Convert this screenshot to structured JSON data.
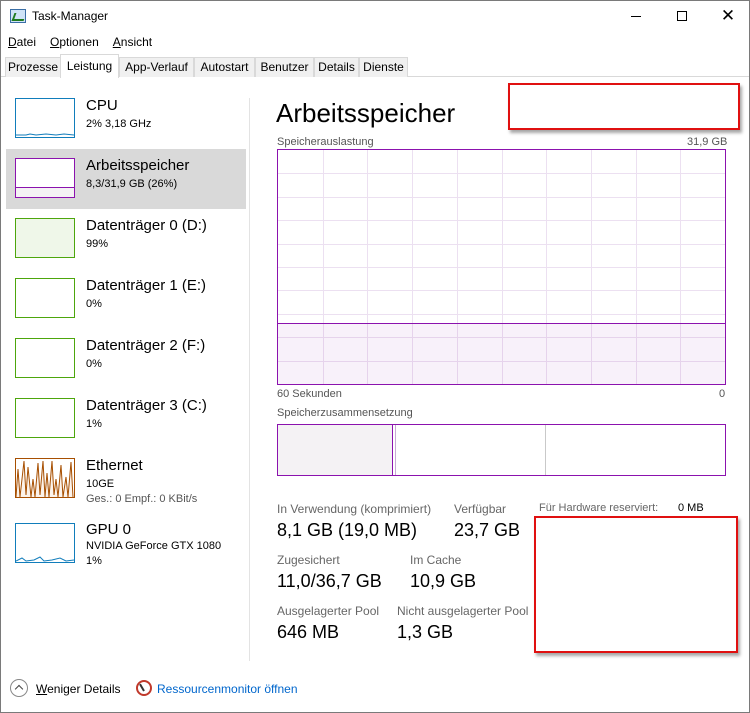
{
  "window": {
    "title": "Task-Manager",
    "close_glyph": "✕"
  },
  "menu": [
    {
      "accel": "D",
      "rest": "atei"
    },
    {
      "accel": "O",
      "rest": "ptionen"
    },
    {
      "accel": "A",
      "rest": "nsicht"
    }
  ],
  "tabs": [
    "Prozesse",
    "Leistung",
    "App-Verlauf",
    "Autostart",
    "Benutzer",
    "Details",
    "Dienste"
  ],
  "active_tab": "Leistung",
  "sidebar": {
    "items": [
      {
        "name": "CPU",
        "sub1": "2% 3,18 GHz",
        "sub2": "",
        "color": "#117dbb",
        "fill": "#f1f6fa",
        "icon": "cpu-graph-icon"
      },
      {
        "name": "Arbeitsspeicher",
        "sub1": "8,3/31,9 GB (26%)",
        "sub2": "",
        "color": "#8b12ae",
        "fill": "#f4f2f4",
        "icon": "memory-graph-icon",
        "level": 0.26
      },
      {
        "name": "Datenträger 0 (D:)",
        "sub1": "99%",
        "sub2": "",
        "color": "#4da60c",
        "fill": "#eff7e9",
        "icon": "disk-graph-icon",
        "level": 0.99
      },
      {
        "name": "Datenträger 1 (E:)",
        "sub1": "0%",
        "sub2": "",
        "color": "#4da60c",
        "fill": "#eff7e9",
        "icon": "disk-graph-icon",
        "level": 0
      },
      {
        "name": "Datenträger 2 (F:)",
        "sub1": "0%",
        "sub2": "",
        "color": "#4da60c",
        "fill": "#eff7e9",
        "icon": "disk-graph-icon",
        "level": 0
      },
      {
        "name": "Datenträger 3 (C:)",
        "sub1": "1%",
        "sub2": "",
        "color": "#4da60c",
        "fill": "#eff7e9",
        "icon": "disk-graph-icon",
        "level": 0.01
      },
      {
        "name": "Ethernet",
        "sub1": "10GE",
        "sub2": "Ges.: 0 Empf.: 0 KBit/s",
        "color": "#a74f01",
        "fill": "#fcf3eb",
        "icon": "ethernet-graph-icon"
      },
      {
        "name": "GPU 0",
        "sub1": "NVIDIA GeForce GTX 1080",
        "sub2": "1%",
        "color": "#117dbb",
        "fill": "#f1f6fa",
        "icon": "gpu-graph-icon"
      }
    ]
  },
  "main": {
    "title": "Arbeitsspeicher",
    "usage_label": "Speicherauslastung",
    "usage_max": "31,9 GB",
    "time_left": "60 Sekunden",
    "time_right": "0",
    "composition_label": "Speicherzusammensetzung",
    "memory_usage_fraction": 0.26,
    "accent": "#8b12ae"
  },
  "stats": {
    "in_use_label": "In Verwendung (komprimiert)",
    "in_use_value": "8,1 GB (19,0 MB)",
    "available_label": "Verfügbar",
    "available_value": "23,7 GB",
    "hw_reserved_label": "Für Hardware reserviert:",
    "hw_reserved_value": "0 MB",
    "committed_label": "Zugesichert",
    "committed_value": "11,0/36,7 GB",
    "cached_label": "Im Cache",
    "cached_value": "10,9 GB",
    "paged_label": "Ausgelagerter Pool",
    "paged_value": "646 MB",
    "nonpaged_label": "Nicht ausgelagerter Pool",
    "nonpaged_value": "1,3 GB"
  },
  "footer": {
    "fewer_details_accel": "W",
    "fewer_details_rest": "eniger Details",
    "resmon_label": "Ressourcenmonitor öffnen"
  }
}
